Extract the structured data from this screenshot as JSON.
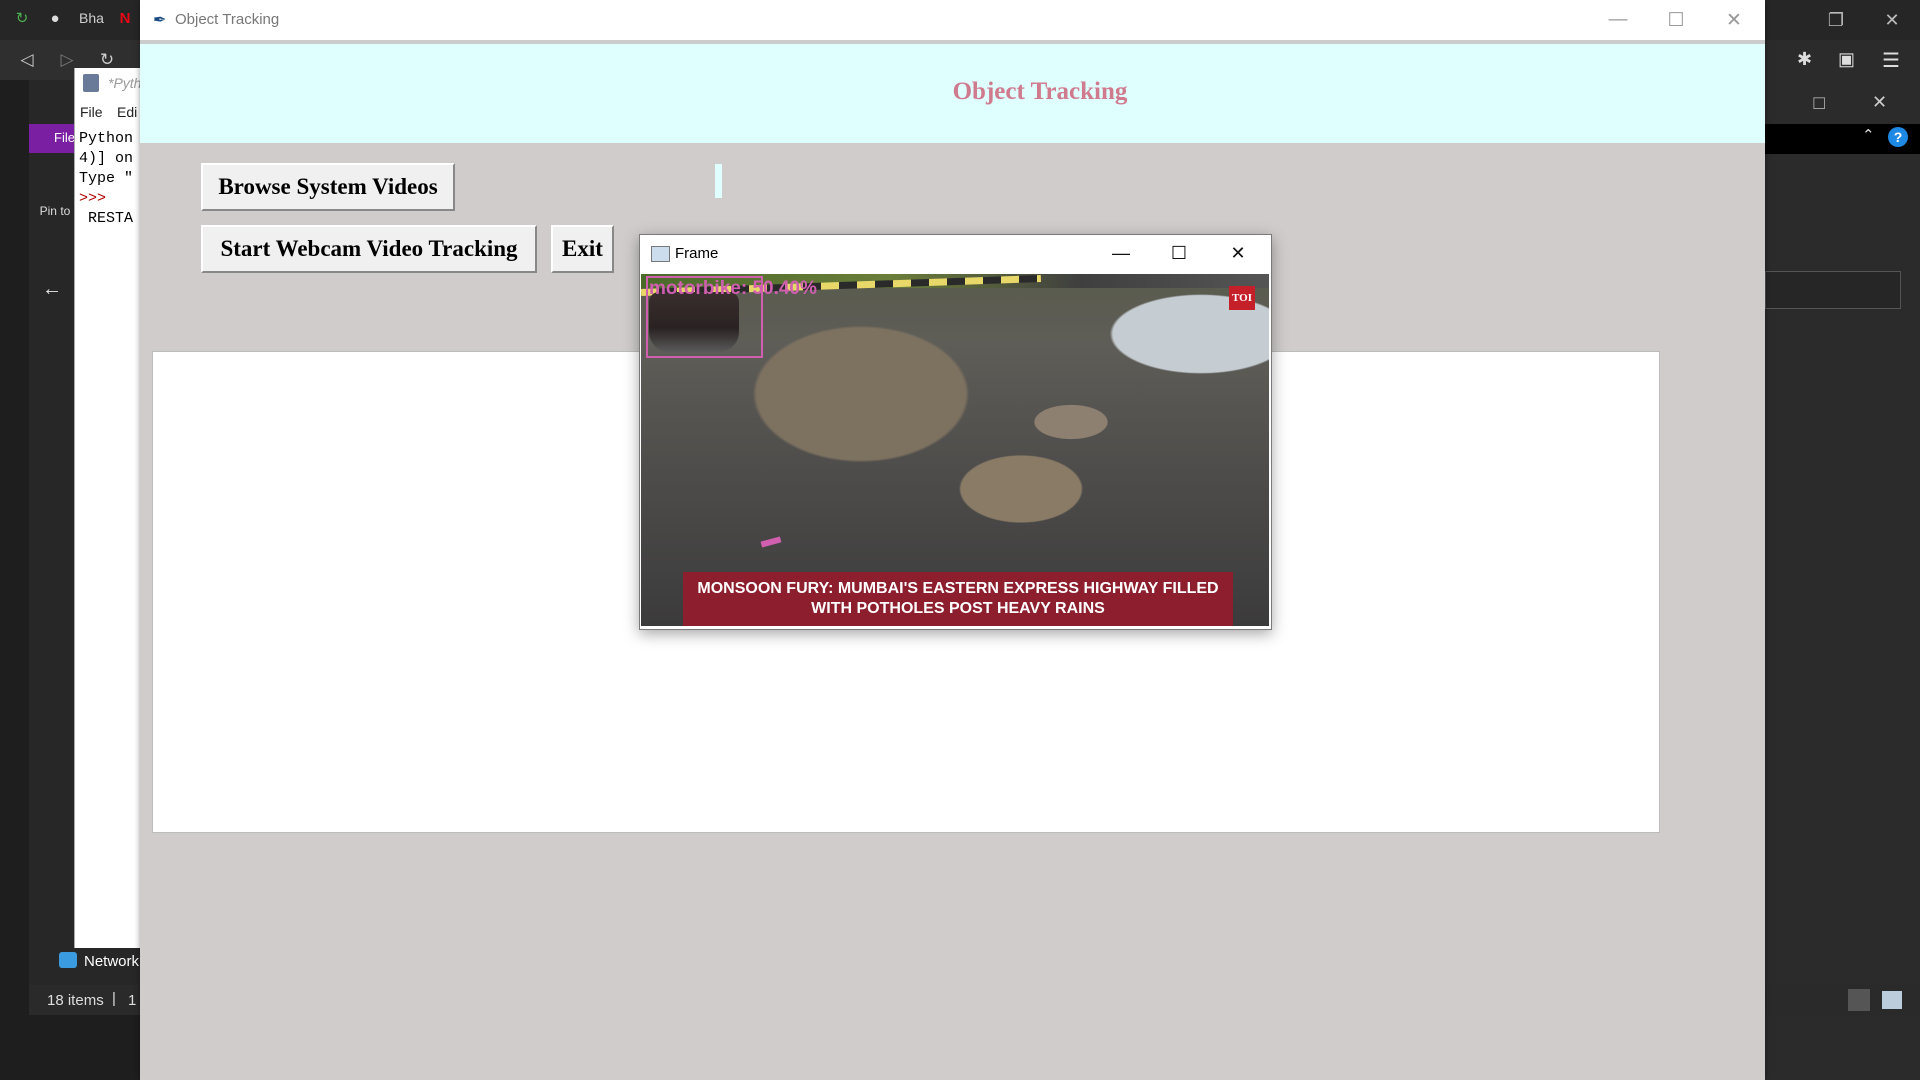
{
  "browser": {
    "tab_text": "Bha",
    "favicons": [
      "refresh-green-icon",
      "github-icon",
      "netflix-icon"
    ],
    "nav": [
      "back-icon",
      "forward-icon",
      "reload-icon"
    ]
  },
  "explorer": {
    "purple_label": "File",
    "pin_text": "Pin to acc",
    "network_label": "Network",
    "items_count": "18 items",
    "items_sep": "|",
    "items_sel": "1"
  },
  "python_shell": {
    "title": "*Pyth",
    "menu_file": "File",
    "menu_edit": "Edi",
    "lines": [
      "Python",
      "4)] on",
      "Type \"",
      ">>>",
      " RESTA"
    ]
  },
  "main_window": {
    "title": "Object Tracking",
    "heading": "Object Tracking",
    "buttons": {
      "browse": "Browse System Videos",
      "webcam": "Start Webcam Video Tracking",
      "exit": "Exit"
    },
    "controls": [
      "minimize-icon",
      "maximize-icon",
      "close-icon"
    ]
  },
  "frame_window": {
    "title": "Frame",
    "detection_label": "motorbike: 50.40%",
    "logo": "TOI",
    "news_banner": "MONSOON FURY: MUMBAI'S EASTERN EXPRESS HIGHWAY FILLED WITH POTHOLES POST HEAVY RAINS"
  },
  "colors": {
    "heading": "#d07a8d",
    "header_bg": "#dfffff",
    "window_bg": "#d0cccc",
    "detection": "#d05fb0",
    "banner": "#8c1e2d"
  }
}
